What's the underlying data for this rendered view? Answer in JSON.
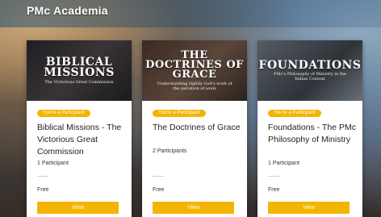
{
  "header": {
    "title": "PMc Academia"
  },
  "courses": [
    {
      "banner_title": "BIBLICAL MISSIONS",
      "banner_subtitle": "The Victorious Great Commission",
      "badge": "You're a Participant",
      "title": "Biblical Missions - The Victorious Great Commission",
      "participants": "1 Participant",
      "price": "Free",
      "button": "View"
    },
    {
      "banner_title": "THE DOCTRINES OF GRACE",
      "banner_subtitle": "Understanding rightly God's work of the salvation of souls",
      "badge": "You're a Participant",
      "title": "The Doctrines of Grace",
      "participants": "2 Participants",
      "price": "Free",
      "button": "View"
    },
    {
      "banner_title": "FOUNDATIONS",
      "banner_subtitle": "PMc's Philosophy of Ministry in the Indian Context",
      "badge": "You're a Participant",
      "title": "Foundations - The PMc Philosophy of Ministry",
      "participants": "1 Participant",
      "price": "Free",
      "button": "View"
    }
  ],
  "colors": {
    "accent": "#f4b400",
    "card_bg": "#ffffff"
  }
}
